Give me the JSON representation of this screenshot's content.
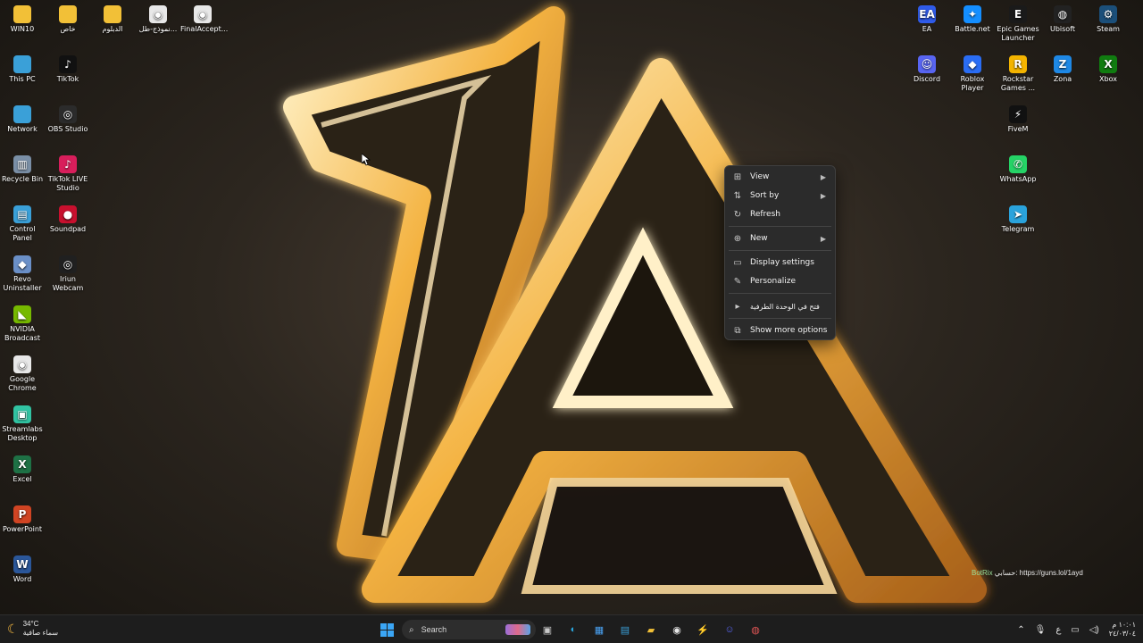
{
  "desktop_left": [
    {
      "label": "WIN10",
      "icon": "folder-icon",
      "color": "#f2c037",
      "glyph": ""
    },
    {
      "label": "خاص",
      "icon": "folder-icon",
      "color": "#f2c037",
      "glyph": ""
    },
    {
      "label": "الدبلوم",
      "icon": "folder-icon",
      "color": "#f2c037",
      "glyph": ""
    },
    {
      "label": "نموذج-طل...",
      "icon": "chrome-icon",
      "color": "#e8e8e8",
      "glyph": "◉"
    },
    {
      "label": "FinalAccept...",
      "icon": "chrome-icon",
      "color": "#e8e8e8",
      "glyph": "◉"
    },
    {
      "label": "This PC",
      "icon": "monitor-icon",
      "color": "#3aa0d8",
      "glyph": ""
    },
    {
      "label": "TikTok",
      "icon": "tiktok-icon",
      "color": "#111111",
      "glyph": "♪"
    },
    {
      "label": "Network",
      "icon": "network-icon",
      "color": "#3aa0d8",
      "glyph": ""
    },
    {
      "label": "OBS Studio",
      "icon": "obs-icon",
      "color": "#2b2b2b",
      "glyph": "◎"
    },
    {
      "label": "Recycle Bin",
      "icon": "recycle-bin-icon",
      "color": "#7a8fa6",
      "glyph": "▥"
    },
    {
      "label": "TikTok LIVE Studio",
      "icon": "tiktok-live-icon",
      "color": "#d81e5b",
      "glyph": "♪"
    },
    {
      "label": "Control Panel",
      "icon": "control-panel-icon",
      "color": "#3aa0d8",
      "glyph": "▤"
    },
    {
      "label": "Soundpad",
      "icon": "soundpad-icon",
      "color": "#c8102e",
      "glyph": "●"
    },
    {
      "label": "Revo Uninstaller",
      "icon": "revo-icon",
      "color": "#6a8fc7",
      "glyph": "◆"
    },
    {
      "label": "Iriun Webcam",
      "icon": "webcam-icon",
      "color": "#202020",
      "glyph": "◎"
    },
    {
      "label": "NVIDIA Broadcast",
      "icon": "nvidia-icon",
      "color": "#76b900",
      "glyph": "◣"
    },
    {
      "label": "Google Chrome",
      "icon": "chrome-icon",
      "color": "#e8e8e8",
      "glyph": "◉"
    },
    {
      "label": "Streamlabs Desktop",
      "icon": "streamlabs-icon",
      "color": "#31c3a2",
      "glyph": "▣"
    },
    {
      "label": "Excel",
      "icon": "excel-icon",
      "color": "#1e7145",
      "glyph": "X"
    },
    {
      "label": "PowerPoint",
      "icon": "powerpoint-icon",
      "color": "#d04423",
      "glyph": "P"
    },
    {
      "label": "Word",
      "icon": "word-icon",
      "color": "#2b579a",
      "glyph": "W"
    }
  ],
  "desktop_right": [
    {
      "label": "EA",
      "icon": "ea-icon",
      "color": "#2f5bea",
      "glyph": "EA"
    },
    {
      "label": "Battle.net",
      "icon": "battlenet-icon",
      "color": "#148eff",
      "glyph": "✦"
    },
    {
      "label": "Epic Games Launcher",
      "icon": "epic-games-icon",
      "color": "#1a1a1a",
      "glyph": "E"
    },
    {
      "label": "Ubisoft",
      "icon": "ubisoft-icon",
      "color": "#222222",
      "glyph": "◍"
    },
    {
      "label": "Steam",
      "icon": "steam-icon",
      "color": "#1b4f7a",
      "glyph": "⚙"
    },
    {
      "label": "Discord",
      "icon": "discord-icon",
      "color": "#5865f2",
      "glyph": "☺"
    },
    {
      "label": "Roblox Player",
      "icon": "roblox-icon",
      "color": "#2a6df4",
      "glyph": "◆"
    },
    {
      "label": "Rockstar Games ...",
      "icon": "rockstar-icon",
      "color": "#f4b400",
      "glyph": "R"
    },
    {
      "label": "Zona",
      "icon": "zona-icon",
      "color": "#1e88e5",
      "glyph": "Z"
    },
    {
      "label": "Xbox",
      "icon": "xbox-icon",
      "color": "#107c10",
      "glyph": "X"
    },
    {
      "label": "FiveM",
      "icon": "fivem-icon",
      "color": "#111111",
      "glyph": "⚡"
    },
    {
      "label": "WhatsApp",
      "icon": "whatsapp-icon",
      "color": "#25d366",
      "glyph": "✆"
    },
    {
      "label": "Telegram",
      "icon": "telegram-icon",
      "color": "#2aa3dc",
      "glyph": "➤"
    }
  ],
  "context_menu": {
    "items": [
      {
        "label": "View",
        "icon": "grid-view-icon",
        "glyph": "⊞",
        "submenu": true
      },
      {
        "label": "Sort by",
        "icon": "sort-icon",
        "glyph": "⇅",
        "submenu": true
      },
      {
        "label": "Refresh",
        "icon": "refresh-icon",
        "glyph": "↻",
        "submenu": false
      },
      {
        "label": "New",
        "icon": "new-plus-icon",
        "glyph": "⊕",
        "submenu": true
      },
      {
        "label": "Display settings",
        "icon": "display-icon",
        "glyph": "▭",
        "submenu": false
      },
      {
        "label": "Personalize",
        "icon": "brush-icon",
        "glyph": "✎",
        "submenu": false
      },
      {
        "label": "فتح في الوحدة الطرفية",
        "icon": "terminal-icon",
        "glyph": "▸",
        "submenu": false
      },
      {
        "label": "Show more options",
        "icon": "more-options-icon",
        "glyph": "⧉",
        "submenu": false
      }
    ]
  },
  "taskbar": {
    "weather_temp": "34°C",
    "weather_desc": "سماء صافية",
    "search_placeholder": "Search",
    "clock_time": "١٠:٠١ م",
    "clock_date": "٢٤/٠٣/٠٤",
    "lang_indicator": "ع"
  },
  "overlay": {
    "bot_name": "BotRix",
    "bot_text": "حسابي: https://guns.lol/1ayd"
  }
}
